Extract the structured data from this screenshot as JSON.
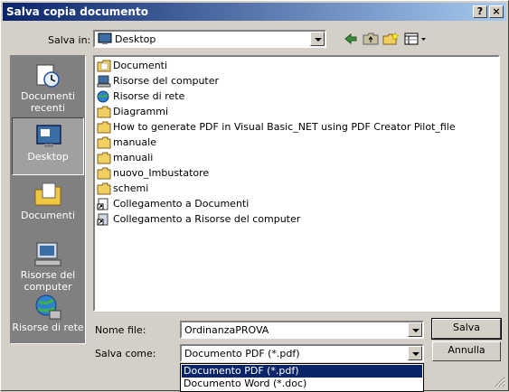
{
  "window": {
    "title": "Salva copia documento",
    "help_label": "?",
    "close_label": "×"
  },
  "lookin": {
    "label": "Salva in:",
    "value": "Desktop"
  },
  "places": [
    {
      "label": "Documenti recenti"
    },
    {
      "label": "Desktop"
    },
    {
      "label": "Documenti"
    },
    {
      "label": "Risorse del computer"
    },
    {
      "label": "Risorse di rete"
    }
  ],
  "files": [
    {
      "name": "Documenti",
      "icon": "folder-docs-icon"
    },
    {
      "name": "Risorse del computer",
      "icon": "computer-icon"
    },
    {
      "name": "Risorse di rete",
      "icon": "network-icon"
    },
    {
      "name": "Diagrammi",
      "icon": "folder-icon"
    },
    {
      "name": "How to generate PDF in Visual Basic_NET using PDF Creator Pilot_file",
      "icon": "folder-icon"
    },
    {
      "name": "manuale",
      "icon": "folder-icon"
    },
    {
      "name": "manuali",
      "icon": "folder-icon"
    },
    {
      "name": "nuovo_Imbustatore",
      "icon": "folder-icon"
    },
    {
      "name": "schemi",
      "icon": "folder-icon"
    },
    {
      "name": "Collegamento a Documenti",
      "icon": "shortcut-icon"
    },
    {
      "name": "Collegamento a Risorse del computer",
      "icon": "shortcut-icon"
    }
  ],
  "filename": {
    "label": "Nome file:",
    "value": "OrdinanzaPROVA"
  },
  "savetype": {
    "label": "Salva come:",
    "value": "Documento PDF (*.pdf)",
    "options": [
      "Documento PDF (*.pdf)",
      "Documento Word (*.doc)"
    ]
  },
  "buttons": {
    "save": "Salva",
    "cancel": "Annulla"
  },
  "colors": {
    "title_start": "#0a246a",
    "title_end": "#a6caf0",
    "face": "#d4d0c8",
    "selection": "#0a246a"
  }
}
